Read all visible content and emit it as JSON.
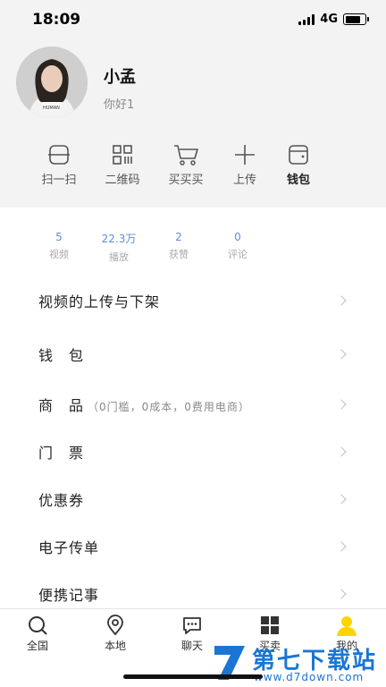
{
  "status_bar": {
    "time": "18:09",
    "network": "4G",
    "battery_level": 0.8
  },
  "profile": {
    "username": "小孟",
    "bio": "你好1"
  },
  "quick_actions": [
    {
      "label": "扫一扫",
      "icon": "scan-icon"
    },
    {
      "label": "二维码",
      "icon": "qrcode-icon"
    },
    {
      "label": "买买买",
      "icon": "cart-icon"
    },
    {
      "label": "上传",
      "icon": "plus-icon"
    },
    {
      "label": "钱包",
      "icon": "wallet-icon"
    }
  ],
  "stats": [
    {
      "value": "5",
      "label": "视频"
    },
    {
      "value": "22.3万",
      "label": "播放"
    },
    {
      "value": "2",
      "label": "获赞"
    },
    {
      "value": "0",
      "label": "评论"
    }
  ],
  "menu": [
    {
      "label": "视频的上传与下架",
      "sub": ""
    },
    {
      "label": "钱　包",
      "sub": ""
    },
    {
      "label": "商　品",
      "sub": "（0门槛，0成本，0费用电商）"
    },
    {
      "label": "门　票",
      "sub": ""
    },
    {
      "label": "优惠券",
      "sub": ""
    },
    {
      "label": "电子传单",
      "sub": ""
    },
    {
      "label": "便携记事",
      "sub": ""
    }
  ],
  "tabbar": [
    {
      "label": "全国",
      "icon": "search-icon"
    },
    {
      "label": "本地",
      "icon": "location-icon"
    },
    {
      "label": "聊天",
      "icon": "chat-icon"
    },
    {
      "label": "买卖",
      "icon": "grid-icon"
    },
    {
      "label": "我的",
      "icon": "user-icon",
      "active": true
    }
  ],
  "watermark": {
    "title": "第七下载站",
    "url": "www.d7down.com"
  },
  "colors": {
    "header_bg": "#f3f3f3",
    "stat_value": "#5d8fd6",
    "active_tab": "#ffd400",
    "watermark": "#1b76d3"
  }
}
